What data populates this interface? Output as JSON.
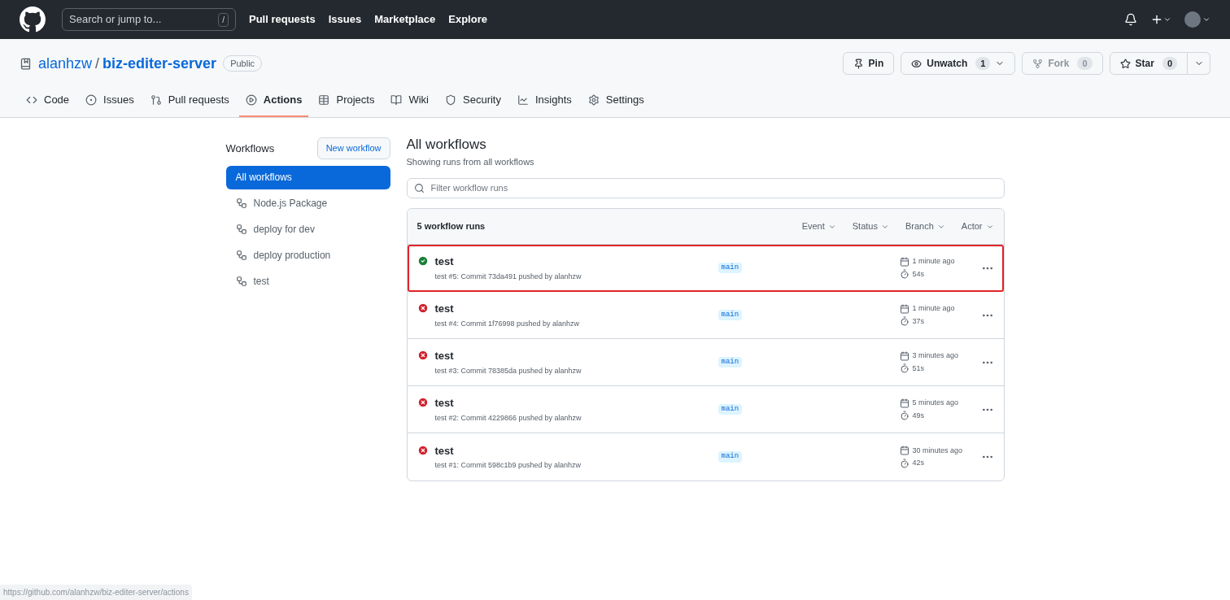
{
  "header": {
    "search_placeholder": "Search or jump to...",
    "search_key": "/",
    "nav": [
      "Pull requests",
      "Issues",
      "Marketplace",
      "Explore"
    ]
  },
  "repo": {
    "owner": "alanhzw",
    "separator": "/",
    "name": "biz-editer-server",
    "visibility": "Public",
    "actions": [
      {
        "kind": "pin",
        "label": "Pin"
      },
      {
        "kind": "watch",
        "label": "Unwatch",
        "count": "1"
      },
      {
        "kind": "fork",
        "label": "Fork",
        "count": "0",
        "disabled": true
      },
      {
        "kind": "star",
        "label": "Star",
        "count": "0"
      }
    ]
  },
  "tabs": [
    {
      "kind": "code",
      "label": "Code",
      "selected": false
    },
    {
      "kind": "issues",
      "label": "Issues",
      "selected": false
    },
    {
      "kind": "pulls",
      "label": "Pull requests",
      "selected": false
    },
    {
      "kind": "actions",
      "label": "Actions",
      "selected": true
    },
    {
      "kind": "projects",
      "label": "Projects",
      "selected": false
    },
    {
      "kind": "wiki",
      "label": "Wiki",
      "selected": false
    },
    {
      "kind": "security",
      "label": "Security",
      "selected": false
    },
    {
      "kind": "insights",
      "label": "Insights",
      "selected": false
    },
    {
      "kind": "settings",
      "label": "Settings",
      "selected": false
    }
  ],
  "sidebar": {
    "title": "Workflows",
    "new_button": "New workflow",
    "items": [
      {
        "label": "All workflows",
        "selected": true
      },
      {
        "label": "Node.js Package",
        "selected": false
      },
      {
        "label": "deploy for dev",
        "selected": false
      },
      {
        "label": "deploy production",
        "selected": false
      },
      {
        "label": "test",
        "selected": false
      }
    ]
  },
  "main": {
    "title": "All workflows",
    "subtitle": "Showing runs from all workflows",
    "filter_placeholder": "Filter workflow runs",
    "runs_count": "5 workflow runs",
    "filters": [
      "Event",
      "Status",
      "Branch",
      "Actor"
    ],
    "runs": [
      {
        "kind": "success",
        "title": "test",
        "detail": "test #5: Commit 73da491 pushed by alanhzw",
        "branch": "main",
        "time": "1 minute ago",
        "duration": "54s",
        "highlighted": true
      },
      {
        "kind": "failure",
        "title": "test",
        "detail": "test #4: Commit 1f76998 pushed by alanhzw",
        "branch": "main",
        "time": "1 minute ago",
        "duration": "37s",
        "highlighted": false
      },
      {
        "kind": "failure",
        "title": "test",
        "detail": "test #3: Commit 78385da pushed by alanhzw",
        "branch": "main",
        "time": "3 minutes ago",
        "duration": "51s",
        "highlighted": false
      },
      {
        "kind": "failure",
        "title": "test",
        "detail": "test #2: Commit 4229866 pushed by alanhzw",
        "branch": "main",
        "time": "5 minutes ago",
        "duration": "49s",
        "highlighted": false
      },
      {
        "kind": "failure",
        "title": "test",
        "detail": "test #1: Commit 598c1b9 pushed by alanhzw",
        "branch": "main",
        "time": "30 minutes ago",
        "duration": "42s",
        "highlighted": false
      }
    ]
  },
  "status_bar": {
    "url": "https://github.com/alanhzw/biz-editer-server/actions"
  }
}
